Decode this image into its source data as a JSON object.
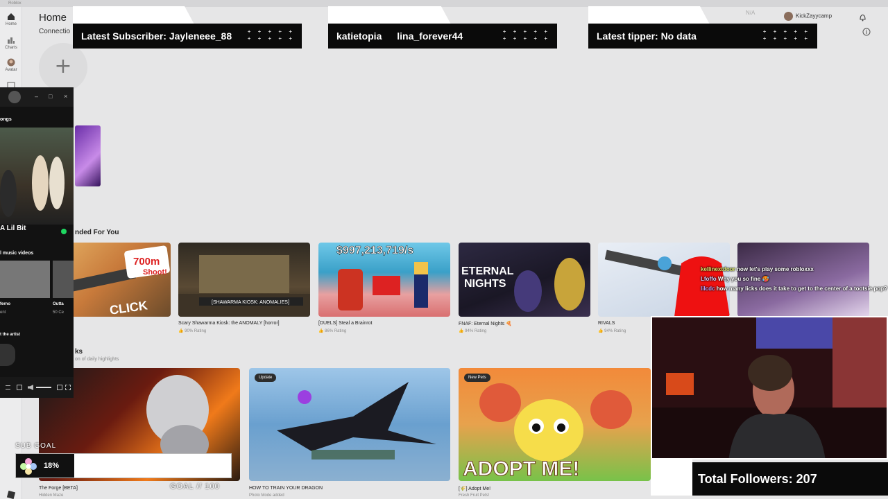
{
  "app": {
    "title": "Roblox"
  },
  "sidebar": {
    "items": [
      {
        "label": "Home",
        "icon": "home-icon"
      },
      {
        "label": "Charts",
        "icon": "charts-icon"
      },
      {
        "label": "Avatar",
        "icon": "avatar-icon"
      }
    ]
  },
  "header": {
    "title": "Home",
    "subtitle": "Connectio",
    "user": "KickZayycamp",
    "robux": "N/A"
  },
  "overlays": {
    "subscriber": "Latest Subscriber: Jayleneee_88",
    "names": [
      "katietopia",
      "lina_forever44"
    ],
    "tipper": "Latest tipper: No data",
    "followers": "Total Followers: 207",
    "subgoal_label": "SUB GOAL",
    "subgoal_pct": "18%",
    "subgoal_progress": 0.18,
    "goal_text": "GOAL // 100"
  },
  "sections": {
    "recommended": "nded For You",
    "highlights": "ks",
    "highlights_sub": "on of daily highlights"
  },
  "games": [
    {
      "name": "",
      "rating": "",
      "thumb_text": "700m Shoot! CLICK"
    },
    {
      "name": "Scary Shawarma Kiosk: the ANOMALY [horror]",
      "rating": "90% Rating",
      "thumb_text": "[SHAWARMA KIOSK: ANOMALIES]"
    },
    {
      "name": "[DUELS] Steal a Brainrot",
      "rating": "86% Rating",
      "thumb_text": "$997,213,719/s"
    },
    {
      "name": "FNAF: Eternal Nights 🍕",
      "rating": "94% Rating",
      "thumb_text": "ETERNAL NIGHTS"
    },
    {
      "name": "RIVALS",
      "rating": "94% Rating",
      "thumb_text": ""
    }
  ],
  "highlights": [
    {
      "name": "The Forge [BETA]",
      "sub": "Hidden Maze",
      "badge": ""
    },
    {
      "name": "HOW TO TRAIN YOUR DRAGON",
      "sub": "Photo Mode added",
      "badge": "Update"
    },
    {
      "name": "[🌾] Adopt Me!",
      "sub": "Fresh Fruit Pets!",
      "badge": "New Pets",
      "thumb_text": "ADOPT ME!"
    }
  ],
  "chat": [
    {
      "user": "kellinextdoor",
      "msg": "now let's play some robloxxx"
    },
    {
      "user": "Lfoffo",
      "msg": "Why you so fine 🥵"
    },
    {
      "user": "lilcdc",
      "msg": "how many licks does it take to get to the center of a tootsie pop?"
    }
  ],
  "spotify": {
    "section1": "ongs",
    "artist": "A Lil Bit",
    "section2": "l music videos",
    "track": "ferno",
    "track_sub": "ent",
    "track2": "Outta",
    "track2_sub": "50 Ce",
    "about": "t the artist"
  },
  "colors": {
    "bg": "#e6e6e7",
    "overlay": "#0a0a0a",
    "accent_chat": "#d7e36a"
  }
}
